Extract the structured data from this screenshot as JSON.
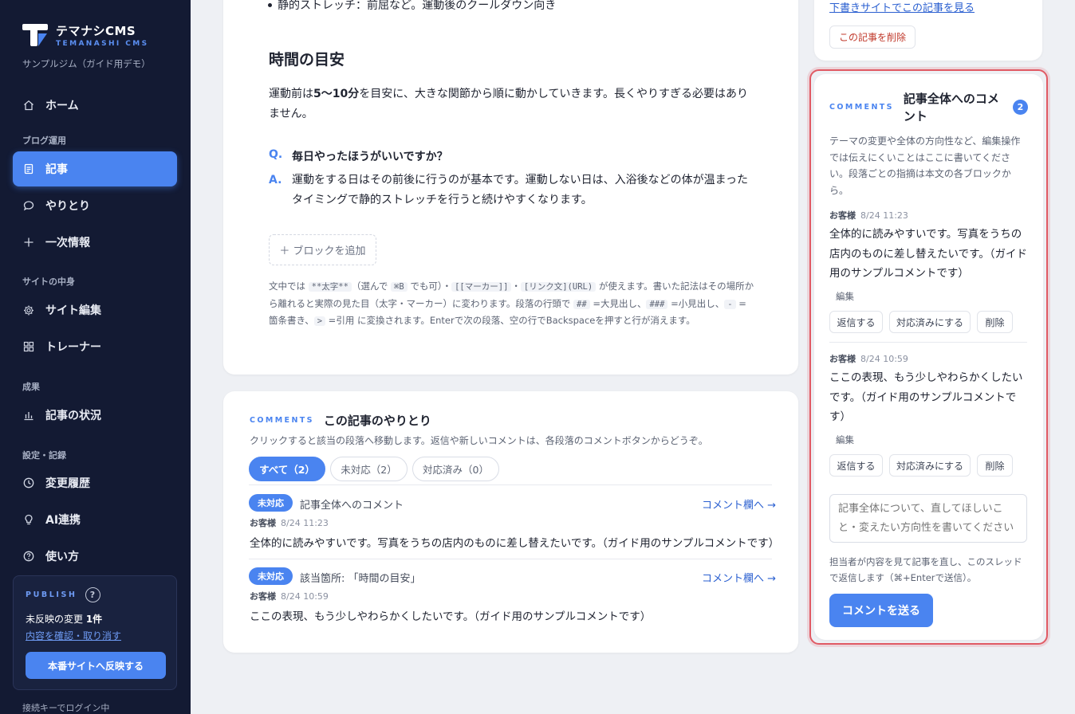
{
  "brand": {
    "title": "テマナシCMS",
    "subtitle": "TEMANASHI CMS",
    "site_name": "サンプルジム（ガイド用デモ）"
  },
  "sidebar": {
    "home": "ホーム",
    "section_blog": "ブログ運用",
    "articles": "記事",
    "exchanges": "やりとり",
    "primary_info": "一次情報",
    "section_site": "サイトの中身",
    "site_edit": "サイト編集",
    "trainers": "トレーナー",
    "section_results": "成果",
    "article_status": "記事の状況",
    "section_settings": "設定・記録",
    "history": "変更履歴",
    "ai": "AI連携",
    "usage": "使い方",
    "icons": [
      "home-icon",
      "document-icon",
      "chat-icon",
      "plus-icon",
      "gear-icon",
      "grid-icon",
      "bar-chart-icon",
      "clock-icon",
      "lightbulb-icon",
      "help-icon"
    ]
  },
  "publish": {
    "label": "PUBLISH",
    "help": "?",
    "status_prefix": "未反映の変更 ",
    "status_count": "1件",
    "review_link": "内容を確認・取り消す",
    "button": "本番サイトへ反映する"
  },
  "login_key": "接続キーでログイン中",
  "article": {
    "bullet_text": "静的ストレッチ：前屈など。運動後のクールダウン向き",
    "heading": "時間の目安",
    "para_prefix": "運動前は",
    "para_bold": "5〜10分",
    "para_suffix": "を目安に、大きな関節から順に動かしていきます。長くやりすぎる必要はありません。",
    "q_mark": "Q.",
    "question": "毎日やったほうがいいですか？",
    "a_mark": "A.",
    "answer": "運動をする日はその前後に行うのが基本です。運動しない日は、入浴後などの体が温まったタイミングで静的ストレッチを行うと続けやすくなります。",
    "add_block": "＋ ブロックを追加",
    "hint": {
      "t1": "文中では ",
      "c1": "**太字**",
      "t2": "（選んで ",
      "c2": "⌘B",
      "t3": " でも可）・",
      "c3": "[[マーカー]]",
      "t4": "・",
      "c4": "[リンク文](URL)",
      "t5": " が使えます。書いた記法はその場所から離れると実際の見た目（太字・マーカー）に変わります。段落の行頭で ",
      "c5": "##",
      "t6": " =大見出し、",
      "c6": "###",
      "t7": " =小見出し、",
      "c7": "-",
      "t8": " =箇条書き、",
      "c8": ">",
      "t9": " =引用 に変換されます。Enterで次の段落、空の行でBackspaceを押すと行が消えます。"
    }
  },
  "comments_list": {
    "label": "COMMENTS",
    "title": "この記事のやりとり",
    "description": "クリックすると該当の段落へ移動します。返信や新しいコメントは、各段落のコメントボタンからどうぞ。",
    "tabs": [
      {
        "label": "すべて（2）"
      },
      {
        "label": "未対応（2）"
      },
      {
        "label": "対応済み（0）"
      }
    ],
    "rows": [
      {
        "badge": "未対応",
        "target": "記事全体へのコメント",
        "jump": "コメント欄へ →",
        "author": "お客様",
        "time": "8/24 11:23",
        "body": "全体的に読みやすいです。写真をうちの店内のものに差し替えたいです。（ガイド用のサンプルコメントです）"
      },
      {
        "badge": "未対応",
        "target": "該当箇所: 「時間の目安」",
        "jump": "コメント欄へ →",
        "author": "お客様",
        "time": "8/24 10:59",
        "body": "ここの表現、もう少しやわらかくしたいです。（ガイド用のサンプルコメントです）"
      }
    ]
  },
  "right_top": {
    "draft_link": "下書きサイトでこの記事を見る",
    "delete_article": "この記事を削除"
  },
  "whole_comments": {
    "label": "COMMENTS",
    "title": "記事全体へのコメント",
    "count": "2",
    "description": "テーマの変更や全体の方向性など、編集操作では伝えにくいことはここに書いてください。段落ごとの指摘は本文の各ブロックから。",
    "items": [
      {
        "author": "お客様",
        "time": "8/24 11:23",
        "body": "全体的に読みやすいです。写真をうちの店内のものに差し替えたいです。（ガイド用のサンプルコメントです）",
        "edit": "編集",
        "reply": "返信する",
        "resolve": "対応済みにする",
        "delete": "削除"
      },
      {
        "author": "お客様",
        "time": "8/24 10:59",
        "body": "ここの表現、もう少しやわらかくしたいです。（ガイド用のサンプルコメントです）",
        "edit": "編集",
        "reply": "返信する",
        "resolve": "対応済みにする",
        "delete": "削除"
      }
    ],
    "input_placeholder": "記事全体について、直してほしいこと・変えたい方向性を書いてください",
    "note": "担当者が内容を見て記事を直し、このスレッドで返信します（⌘+Enterで送信）。",
    "send": "コメントを送る"
  },
  "colors": {
    "accent": "#4a84f0",
    "sidebar": "#131a33",
    "highlight": "#e05a64"
  }
}
